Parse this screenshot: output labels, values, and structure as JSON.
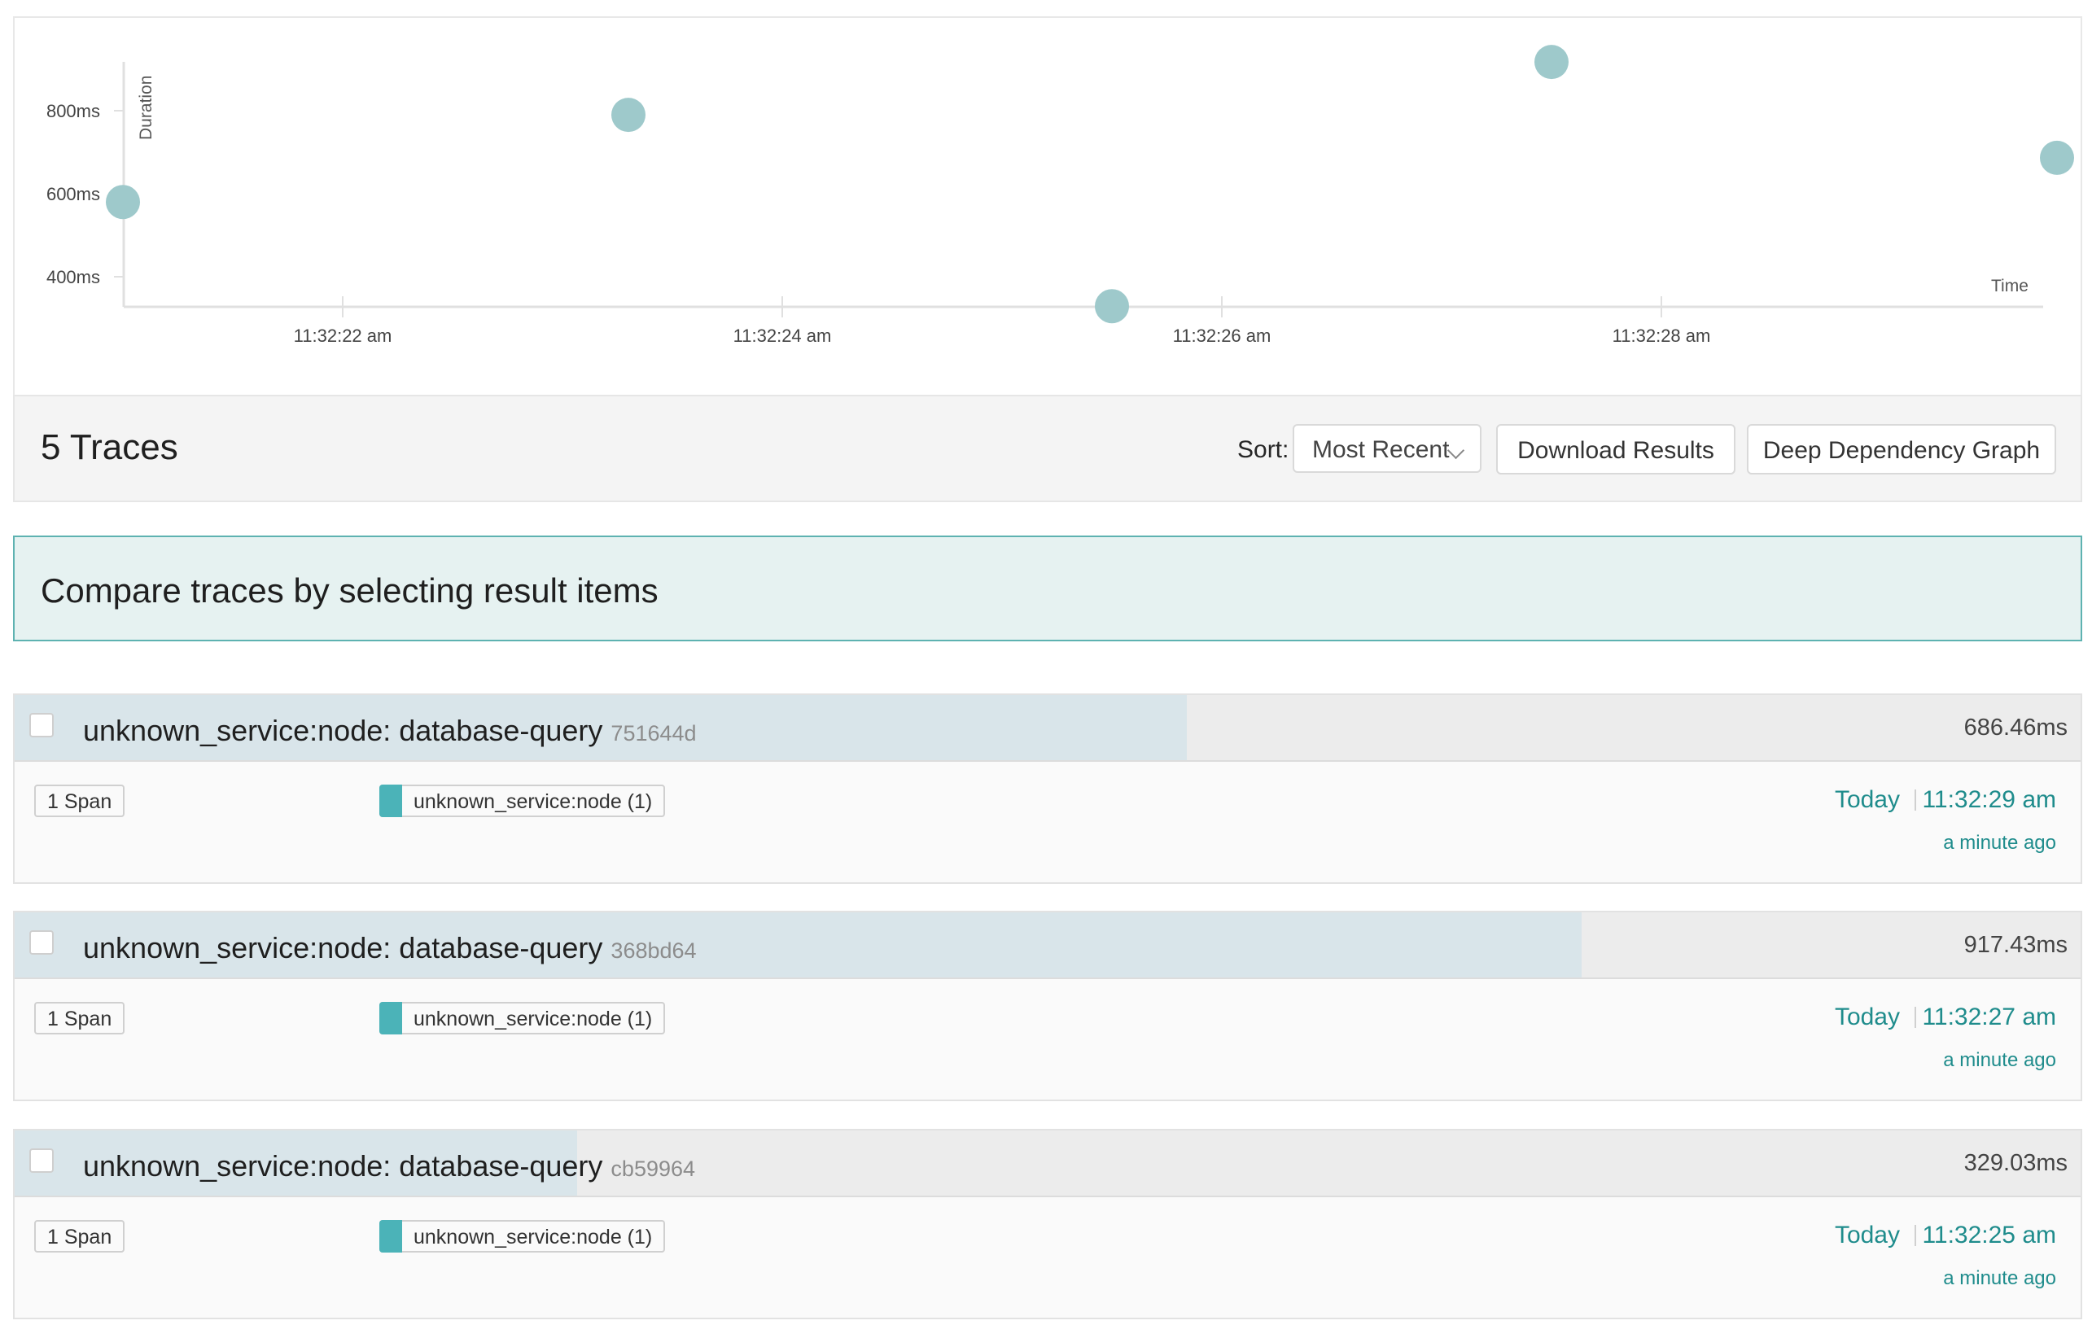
{
  "chart_data": {
    "type": "scatter",
    "xlabel": "Time",
    "ylabel": "Duration",
    "x_ticks": [
      "11:32:22 am",
      "11:32:24 am",
      "11:32:26 am",
      "11:32:28 am"
    ],
    "y_ticks": [
      "400ms",
      "600ms",
      "800ms"
    ],
    "points": [
      {
        "time": "11:32:21",
        "duration_ms": 580
      },
      {
        "time": "11:32:23.3",
        "duration_ms": 790
      },
      {
        "time": "11:32:25.5",
        "duration_ms": 329.03
      },
      {
        "time": "11:32:27.5",
        "duration_ms": 917.43
      },
      {
        "time": "11:32:29.8",
        "duration_ms": 686.46
      }
    ],
    "color": "#9ec9cb"
  },
  "results": {
    "count_label": "5 Traces",
    "sort_label": "Sort:",
    "sort_value": "Most Recent",
    "download_label": "Download Results",
    "ddg_label": "Deep Dependency Graph"
  },
  "compare": {
    "message": "Compare traces by selecting result items"
  },
  "traces": [
    {
      "title": "unknown_service:node: database-query",
      "trace_id": "751644d",
      "duration": "686.46ms",
      "duration_fraction": 0.748,
      "spans": "1 Span",
      "service": "unknown_service:node (1)",
      "date": "Today",
      "time": "11:32:29 am",
      "ago": "a minute ago"
    },
    {
      "title": "unknown_service:node: database-query",
      "trace_id": "368bd64",
      "duration": "917.43ms",
      "duration_fraction": 1.0,
      "spans": "1 Span",
      "service": "unknown_service:node (1)",
      "date": "Today",
      "time": "11:32:27 am",
      "ago": "a minute ago"
    },
    {
      "title": "unknown_service:node: database-query",
      "trace_id": "cb59964",
      "duration": "329.03ms",
      "duration_fraction": 0.359,
      "spans": "1 Span",
      "service": "unknown_service:node (1)",
      "date": "Today",
      "time": "11:32:25 am",
      "ago": "a minute ago"
    }
  ],
  "colors": {
    "accent": "#1f8c8c",
    "service_swatch": "#4bb3b8",
    "duration_bar": "#d9e5ea",
    "banner_bg": "#e6f2f1"
  }
}
